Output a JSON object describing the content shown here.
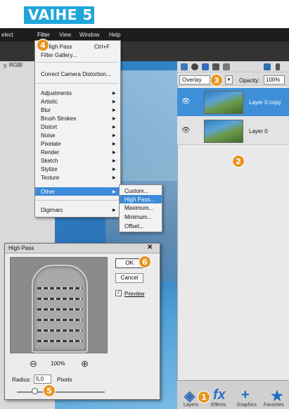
{
  "step_title": "VAIHE 5",
  "menubar": {
    "items": [
      "elect",
      "Filter",
      "View",
      "Window",
      "Help"
    ]
  },
  "path_label": "y, RGB/",
  "filter_menu": {
    "top_items": [
      {
        "label": "High Pass",
        "shortcut": "Ctrl+F"
      },
      {
        "label": "Filter Gallery..."
      }
    ],
    "correct_camera": "Correct Camera Distortion...",
    "categories": [
      "Adjustments",
      "Artistic",
      "Blur",
      "Brush Strokes",
      "Distort",
      "Noise",
      "Pixelate",
      "Render",
      "Sketch",
      "Stylize",
      "Texture",
      "Other"
    ],
    "digimarc": "Digimarc"
  },
  "other_submenu": {
    "items": [
      "Custom...",
      "High Pass...",
      "Maximum...",
      "Minimum...",
      "Offset..."
    ],
    "selected": "High Pass..."
  },
  "layers_panel": {
    "blend_mode": "Overlay",
    "opacity_label": "Opacity:",
    "opacity_value": "100%",
    "layers": [
      {
        "name": "Layer 0 copy",
        "selected": true
      },
      {
        "name": "Layer 0",
        "selected": false
      }
    ]
  },
  "bottom_bar": {
    "labels": [
      "Layers",
      "Effects",
      "Graphics",
      "Favorites"
    ]
  },
  "high_pass_dialog": {
    "title": "High Pass",
    "ok_label": "OK",
    "cancel_label": "Cancel",
    "preview_label": "Preview",
    "preview_checked": true,
    "zoom_value": "100%",
    "radius_label": "Radius:",
    "radius_value": "5,0",
    "pixels_label": "Pixels",
    "radius_slider_fraction": 0.2
  },
  "callouts": [
    "1",
    "2",
    "3",
    "4",
    "5",
    "6"
  ],
  "colors": {
    "accent": "#1fa6d9",
    "highlight": "#3d8bd8",
    "badge": "#e8941f"
  }
}
